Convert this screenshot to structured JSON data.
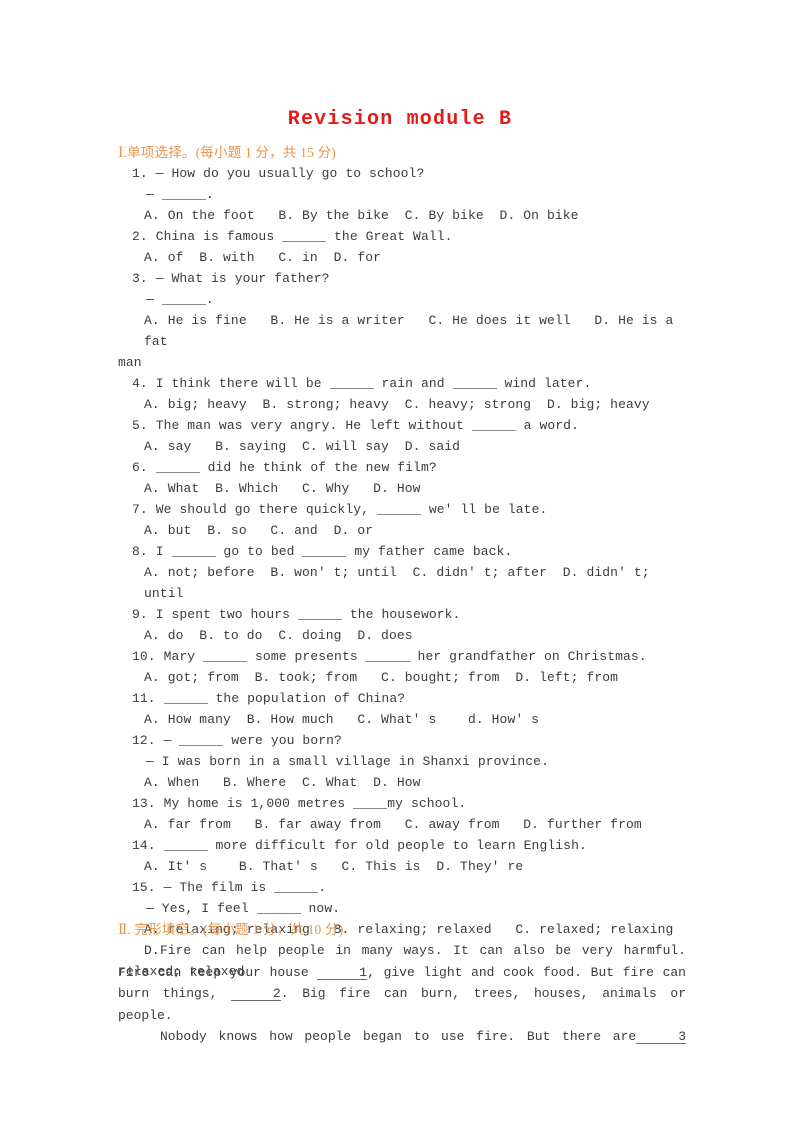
{
  "document": {
    "title": "Revision module B",
    "title_color": "#e41b17",
    "section_color": "#e8944a"
  },
  "sections": [
    {
      "heading": "Ⅰ.单项选择。(每小题 1 分，共 15 分)",
      "questions": [
        {
          "number": "1.",
          "stem": "— How do you usually go to school?",
          "stem2": "— ______.",
          "options": "A. On the foot   B. By the bike  C. By bike  D. On bike"
        },
        {
          "number": "2.",
          "stem": "China is famous ______ the Great Wall.",
          "options": "A. of  B. with   C. in  D. for"
        },
        {
          "number": "3.",
          "stem": "— What is your father?",
          "stem2": "— ______.",
          "options": "A. He is fine   B. He is a writer   C. He does it well   D. He is a fat",
          "options_cont": "man"
        },
        {
          "number": "4.",
          "stem": "I think there will be ______ rain and ______ wind later.",
          "options": "A. big; heavy  B. strong; heavy  C. heavy; strong  D. big; heavy"
        },
        {
          "number": "5.",
          "stem": "The man was very angry. He left without ______ a word.",
          "options": "A. say   B. saying  C. will say  D. said"
        },
        {
          "number": "6.",
          "stem": "______ did he think of the new film?",
          "options": "A. What  B. Which   C. Why   D. How"
        },
        {
          "number": "7.",
          "stem": "We should go there quickly, ______ we' ll be late.",
          "options": "A. but  B. so   C. and  D. or"
        },
        {
          "number": "8.",
          "stem": "I ______ go to bed ______ my father came back.",
          "options": "A. not; before  B. won' t; until  C. didn' t; after  D. didn' t; until"
        },
        {
          "number": "9.",
          "stem": "I spent two hours ______ the housework.",
          "options": "A. do  B. to do  C. doing  D. does"
        },
        {
          "number": "10.",
          "stem": "Mary ______ some presents ______ her grandfather on Christmas.",
          "options": "A. got; from  B. took; from   C. bought; from  D. left; from"
        },
        {
          "number": "11.",
          "stem": "______ the population of China?",
          "options": "A. How many  B. How much   C. What' s    d. How' s"
        },
        {
          "number": "12.",
          "stem": "— ______ were you born?",
          "stem2": "— I was born in a small village in Shanxi province.",
          "options": "A. When   B. Where  C. What  D. How"
        },
        {
          "number": "13.",
          "stem": "My home is 1,000 metres _____my school.",
          "options": "A. far from   B. far away from   C. away from   D. further from"
        },
        {
          "number": "14.",
          "stem": "______ more difficult for old people to learn English.",
          "options": "A. It' s    B. That' s   C. This is  D. They' re"
        },
        {
          "number": "15.",
          "stem": "— The film is ______.",
          "stem2": "— Yes, I feel ______ now.",
          "options": "A. relaxing; relaxing   B. relaxing; relaxed   C. relaxed; relaxing   D.",
          "options_cont": "relaxed; relaxed"
        }
      ]
    },
    {
      "heading": "Ⅱ. 完形填空。(每小题 1 分，共 10 分)",
      "passage": [
        {
          "before": "Fire can help people in many ways. It can also be very harmful. Fire can keep your house ",
          "blank": "1",
          "middle": ", give light and cook food. But fire can burn things, ",
          "blank2": "2",
          "after": ". Big fire can burn, trees, houses, animals or people."
        },
        {
          "before": "Nobody knows how people began to use fire. But there are",
          "blank": "3",
          "middle": "",
          "after": ""
        }
      ]
    }
  ]
}
